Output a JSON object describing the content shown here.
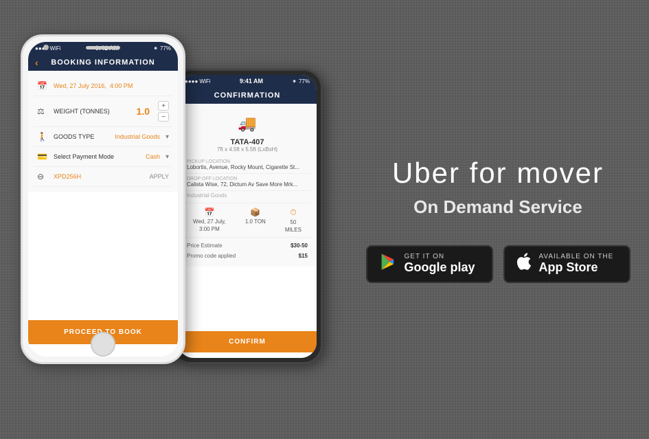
{
  "background": {
    "color": "#636363"
  },
  "right_panel": {
    "title": "Uber for mover",
    "subtitle": "On Demand Service",
    "google_play": {
      "line1": "GET IT ON",
      "line2": "Google play"
    },
    "app_store": {
      "line1": "Available on the",
      "line2": "App Store"
    }
  },
  "phone_white": {
    "status_bar": {
      "dots": "●●●●",
      "wifi": "WiFi",
      "time": "9:41 AM",
      "bluetooth": "⁕",
      "battery": "77%"
    },
    "header": "BOOKING INFORMATION",
    "rows": [
      {
        "icon": "📅",
        "label": "Wed, 27 July 2016,  4:00 PM",
        "value": ""
      },
      {
        "icon": "⚖",
        "label": "WEIGHT (TONNES)",
        "value": "1.0"
      },
      {
        "icon": "🚶",
        "label": "GOODS TYPE",
        "value": "Industrial Goods"
      },
      {
        "icon": "💳",
        "label": "Select Payment Mode",
        "value": "Cash"
      },
      {
        "icon": "⊖",
        "label": "XPD256H",
        "value": "APPLY"
      }
    ],
    "proceed_label": "PROCEED TO BOOK"
  },
  "phone_dark": {
    "status_bar": {
      "time": "9:41 AM",
      "battery": "77%"
    },
    "header": "CONFIRMATION",
    "truck_model": "TATA-407",
    "truck_dims": "7ft x 4.5ft x 5.5ft (LxBxH)",
    "pickup_label": "Pickup location",
    "pickup_value": "Lobortis, Avenue, Rocky Mount, Cigarette St...",
    "dropoff_label": "Drop off location",
    "dropoff_value": "Calista Wise, 72, Dictum Av Save More Mrk...",
    "goods_type": "Industrial Goods",
    "stats": [
      {
        "icon": "📅",
        "line1": "Wed, 27 July,",
        "line2": "3:00 PM"
      },
      {
        "icon": "📦",
        "line1": "1.0 TON"
      },
      {
        "icon": "⏱",
        "line1": "50",
        "line2": "MILES"
      }
    ],
    "price_estimate_label": "Price Estimate",
    "price_estimate_value": "$30-50",
    "promo_label": "Promo code applied",
    "promo_value": "$15",
    "confirm_label": "CONFIRM"
  }
}
